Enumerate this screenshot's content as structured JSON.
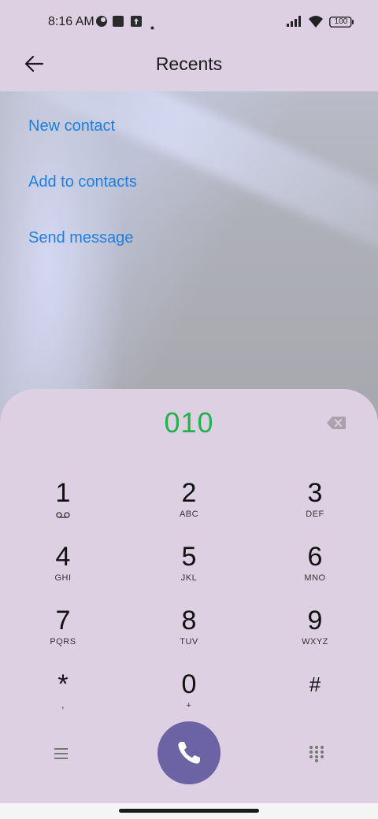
{
  "status_bar": {
    "time": "8:16 AM",
    "battery": "100",
    "icons": [
      "notification-dot-icon",
      "square-app-icon",
      "upload-icon",
      "more-dot-icon",
      "signal-icon",
      "wifi-icon",
      "battery-icon"
    ]
  },
  "header": {
    "title": "Recents",
    "back_icon": "arrow-left-icon"
  },
  "actions": [
    "New contact",
    "Add to contacts",
    "Send message"
  ],
  "dialer": {
    "number": "010",
    "keys": [
      {
        "digit": "1",
        "letters": ""
      },
      {
        "digit": "2",
        "letters": "ABC"
      },
      {
        "digit": "3",
        "letters": "DEF"
      },
      {
        "digit": "4",
        "letters": "GHI"
      },
      {
        "digit": "5",
        "letters": "JKL"
      },
      {
        "digit": "6",
        "letters": "MNO"
      },
      {
        "digit": "7",
        "letters": "PQRS"
      },
      {
        "digit": "8",
        "letters": "TUV"
      },
      {
        "digit": "9",
        "letters": "WXYZ"
      },
      {
        "digit": "*",
        "letters": ","
      },
      {
        "digit": "0",
        "letters": "+"
      },
      {
        "digit": "#",
        "letters": ""
      }
    ]
  },
  "colors": {
    "background": "#ded0e3",
    "accent_link": "#1e7fe0",
    "number": "#22b24c",
    "call_button": "#6b63a4"
  }
}
